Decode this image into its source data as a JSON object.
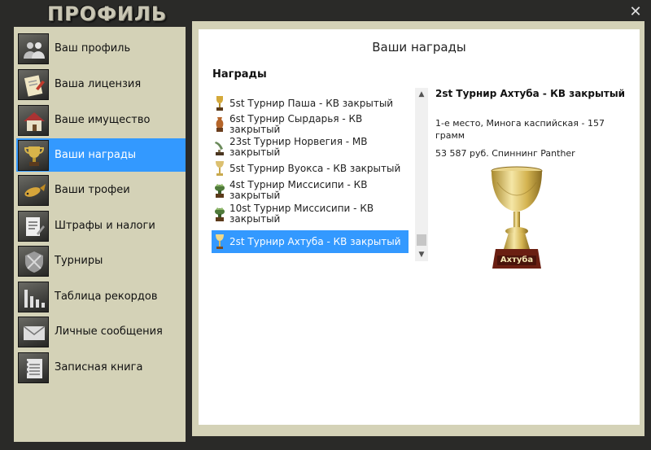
{
  "window": {
    "title": "ПРОФИЛЬ",
    "close_icon": "close-icon"
  },
  "sidebar": {
    "items": [
      {
        "label": "Ваш профиль",
        "icon": "users-icon",
        "active": false
      },
      {
        "label": "Ваша лицензия",
        "icon": "license-icon",
        "active": false
      },
      {
        "label": "Ваше имущество",
        "icon": "house-icon",
        "active": false
      },
      {
        "label": "Ваши награды",
        "icon": "trophy-icon",
        "active": true
      },
      {
        "label": "Ваши трофеи",
        "icon": "fish-icon",
        "active": false
      },
      {
        "label": "Штрафы и налоги",
        "icon": "document-icon",
        "active": false
      },
      {
        "label": "Турниры",
        "icon": "shield-icon",
        "active": false
      },
      {
        "label": "Таблица рекордов",
        "icon": "bar-chart-icon",
        "active": false
      },
      {
        "label": "Личные сообщения",
        "icon": "envelope-icon",
        "active": false
      },
      {
        "label": "Записная книга",
        "icon": "notebook-icon",
        "active": false
      }
    ]
  },
  "main": {
    "title": "Ваши награды",
    "awards_heading": "Награды",
    "awards": [
      {
        "text": "5st Турнир Паша - КВ закрытый",
        "icon": "gold-cup-icon",
        "selected": false
      },
      {
        "text": "6st Турнир Сырдарья - КВ закрытый",
        "icon": "bronze-vase-icon",
        "selected": false
      },
      {
        "text": "23st Турнир Норвегия - МВ закрытый",
        "icon": "fish-statue-icon",
        "selected": false
      },
      {
        "text": "5st Турнир Вуокса - КВ закрытый",
        "icon": "goblet-icon",
        "selected": false
      },
      {
        "text": "4st Турнир Миссисипи - КВ закрытый",
        "icon": "green-trophy-icon",
        "selected": false
      },
      {
        "text": "10st Турнир Миссисипи - КВ закрытый",
        "icon": "green-trophy-icon",
        "selected": false
      },
      {
        "text": "2st Турнир Ахтуба - КВ закрытый",
        "icon": "goblet-icon",
        "selected": true
      }
    ],
    "detail": {
      "title": "2st Турнир Ахтуба - КВ закрытый",
      "line1": "1-е место, Минога каспийская - 157 грамм",
      "line2": "53 587 руб. Спиннинг Panther",
      "cup_label": "Ахтуба"
    }
  },
  "colors": {
    "selection": "#3399ff",
    "sidebar_bg": "#d4d2b7",
    "frame": "#2a2a28"
  }
}
